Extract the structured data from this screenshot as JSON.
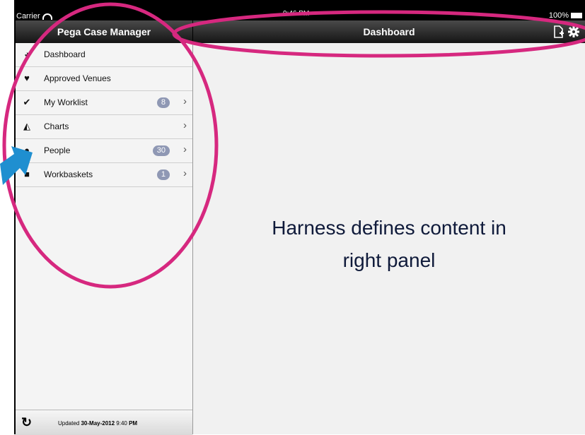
{
  "status_bar": {
    "carrier": "Carrier",
    "time": "9:46 PM",
    "battery": "100%"
  },
  "left_header": {
    "title": "Pega Case Manager"
  },
  "right_header": {
    "title": "Dashboard",
    "icons": [
      "new-case-icon",
      "gear-icon"
    ]
  },
  "menu": [
    {
      "label": "Dashboard",
      "icon": "dashboard-gauge-icon",
      "glyph": "◕",
      "badge": "",
      "chevron": false
    },
    {
      "label": "Approved Venues",
      "icon": "heart-icon",
      "glyph": "♥",
      "badge": "",
      "chevron": false
    },
    {
      "label": "My Worklist",
      "icon": "checkmark-icon",
      "glyph": "✔",
      "badge": "8",
      "chevron": true
    },
    {
      "label": "Charts",
      "icon": "area-chart-icon",
      "glyph": "◭",
      "badge": "",
      "chevron": true
    },
    {
      "label": "People",
      "icon": "person-icon",
      "glyph": "●",
      "badge": "30",
      "chevron": true
    },
    {
      "label": "Workbaskets",
      "icon": "briefcase-icon",
      "glyph": "■",
      "badge": "1",
      "chevron": true
    }
  ],
  "chevron_glyph": "›",
  "footer": {
    "refresh_glyph": "↻",
    "prefix": "Updated ",
    "date": "30-May-2012",
    "time": " 9:40 ",
    "ampm": "PM"
  },
  "annotation": {
    "line1": "Harness defines content in",
    "line2": "right panel"
  },
  "colors": {
    "highlight": "#d6287f",
    "arrow": "#1f8fd0",
    "badge": "#8f98b4"
  }
}
